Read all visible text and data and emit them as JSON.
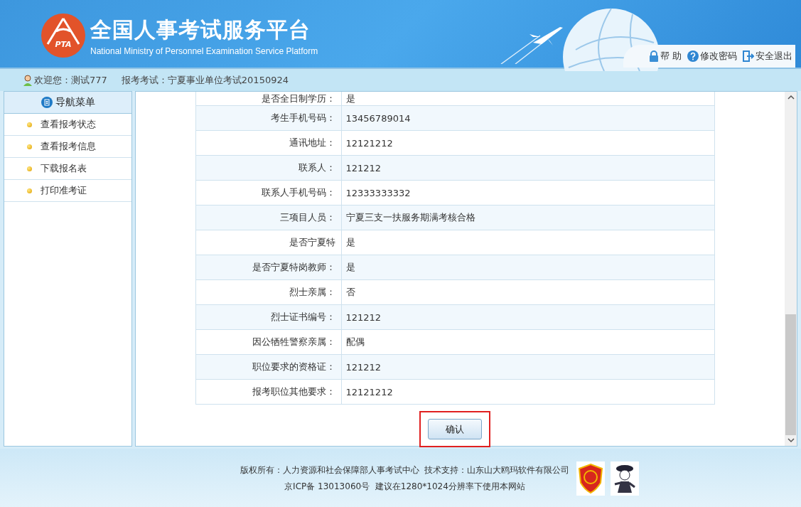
{
  "header": {
    "logo_text": "PTA",
    "title": "全国人事考试服务平台",
    "subtitle": "National Ministry of Personnel Examination Service Platform",
    "links": [
      {
        "kind": "lock",
        "label": "帮 助"
      },
      {
        "kind": "help",
        "label": "修改密码"
      },
      {
        "kind": "exit",
        "label": "安全退出"
      }
    ]
  },
  "user_bar": {
    "welcome": "欢迎您：测试777",
    "exam": "报考考试：宁夏事业单位考试20150924"
  },
  "sidebar": {
    "title": "导航菜单",
    "items": [
      {
        "label": "查看报考状态"
      },
      {
        "label": "查看报考信息"
      },
      {
        "label": "下载报名表"
      },
      {
        "label": "打印准考证"
      }
    ]
  },
  "table": {
    "rows": [
      {
        "label": "是否全日制学历：",
        "value": "是"
      },
      {
        "label": "考生手机号码：",
        "value": "13456789014"
      },
      {
        "label": "通讯地址：",
        "value": "12121212"
      },
      {
        "label": "联系人：",
        "value": "121212"
      },
      {
        "label": "联系人手机号码：",
        "value": "12333333332"
      },
      {
        "label": "三项目人员：",
        "value": "宁夏三支一扶服务期满考核合格"
      },
      {
        "label": "是否宁夏特",
        "value": "是"
      },
      {
        "label": "是否宁夏特岗教师：",
        "value": "是"
      },
      {
        "label": "烈士亲属：",
        "value": "否"
      },
      {
        "label": "烈士证书编号：",
        "value": "121212"
      },
      {
        "label": "因公牺牲警察亲属：",
        "value": "配偶"
      },
      {
        "label": "职位要求的资格证：",
        "value": "121212"
      },
      {
        "label": "报考职位其他要求：",
        "value": "12121212"
      }
    ]
  },
  "confirm_button": {
    "label": "确认",
    "highlighted": true
  },
  "footer": {
    "lines": [
      "版权所有：人力资源和社会保障部人事考试中心  技术支持：山东山大鸥玛软件有限公司",
      "京ICP备 13013060号  建议在1280*1024分辨率下使用本网站"
    ]
  }
}
